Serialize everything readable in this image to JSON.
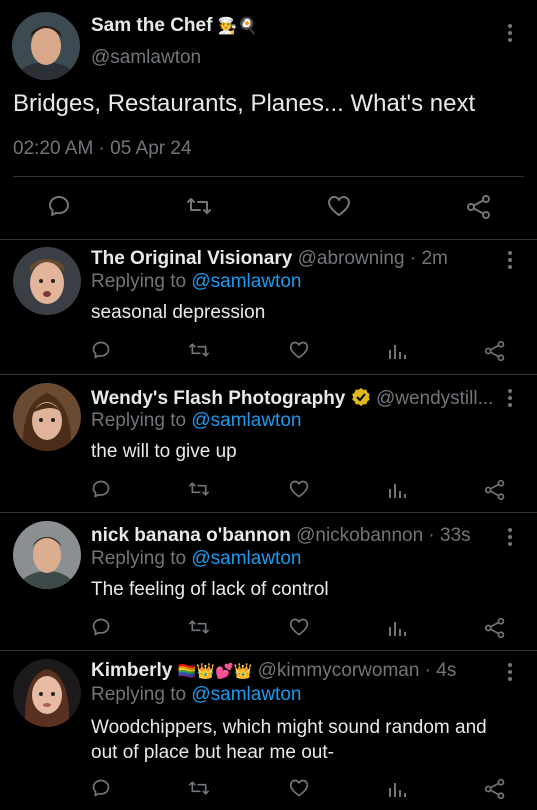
{
  "main_tweet": {
    "author_name": "Sam the Chef",
    "author_emoji": "🧑‍🍳🍳",
    "handle": "@samlawton",
    "text": "Bridges, Restaurants, Planes... What's next",
    "timestamp": "02:20 AM · 05 Apr 24"
  },
  "replies": [
    {
      "name": "The Original Visionary",
      "handle_time": "@abrowning · 2m",
      "replying_prefix": "Replying to",
      "replying_handle": "@samlawton",
      "text": "seasonal depression"
    },
    {
      "name": "Wendy's Flash Photography",
      "handle_time": "@wendystill...",
      "replying_prefix": "Replying to",
      "replying_handle": "@samlawton",
      "text": "the will to give up"
    },
    {
      "name": "nick banana o'bannon",
      "handle_time": "@nickobannon · 33s",
      "replying_prefix": "Replying to",
      "replying_handle": "@samlawton",
      "text": "The feeling of lack of control"
    },
    {
      "name": "Kimberly",
      "name_emoji": "🏳️‍🌈👑💕👑",
      "handle_time": "@kimmycorwoman · 4s",
      "replying_prefix": "Replying to",
      "replying_handle": "@samlawton",
      "text_line1": "Woodchippers, which might sound random and",
      "text_line2": "out of place but hear me out-"
    }
  ],
  "colors": {
    "background": "#000000",
    "text": "#e7e9ea",
    "secondary": "#71767b",
    "accent": "#1d9bf0",
    "verified": "#e2b719"
  }
}
